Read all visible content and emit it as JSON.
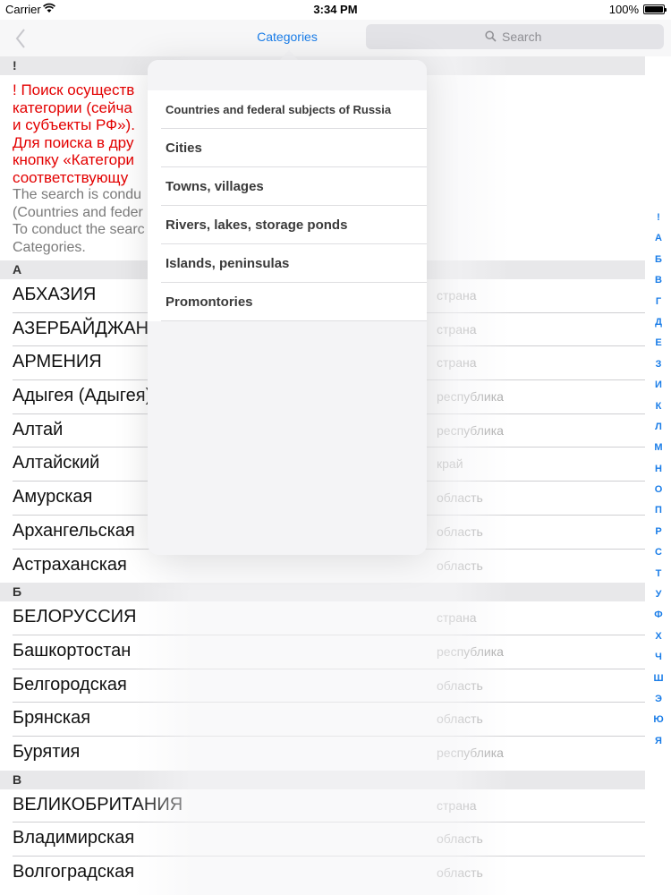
{
  "status_bar": {
    "carrier": "Carrier",
    "time": "3:34 PM",
    "battery": "100%"
  },
  "nav": {
    "categories_label": "Categories",
    "search_placeholder": "Search",
    "accent_color": "#1a7de8"
  },
  "intro": {
    "header": "!",
    "red_lines": [
      "! Поиск осуществ",
      "категории (сейча",
      "и субъекты РФ»).",
      "Для поиска в дру",
      "кнопку «Категори",
      "соответствующу"
    ],
    "gray_lines": [
      "The search is condu",
      "(Countries and feder",
      "To conduct the searc",
      "Categories."
    ]
  },
  "sections": [
    {
      "letter": "А",
      "rows": [
        {
          "name": "АБХАЗИЯ",
          "type": "страна"
        },
        {
          "name": "АЗЕРБАЙДЖАН",
          "type": "страна"
        },
        {
          "name": "АРМЕНИЯ",
          "type": "страна"
        },
        {
          "name": "Адыгея (Адыгея)",
          "type": "республика"
        },
        {
          "name": "Алтай",
          "type": "республика"
        },
        {
          "name": "Алтайский",
          "type": "край"
        },
        {
          "name": "Амурская",
          "type": "область"
        },
        {
          "name": "Архангельская",
          "type": "область"
        },
        {
          "name": "Астраханская",
          "type": "область"
        }
      ]
    },
    {
      "letter": "Б",
      "rows": [
        {
          "name": "БЕЛОРУССИЯ",
          "type": "страна"
        },
        {
          "name": "Башкортостан",
          "type": "республика"
        },
        {
          "name": "Белгородская",
          "type": "область"
        },
        {
          "name": "Брянская",
          "type": "область"
        },
        {
          "name": "Бурятия",
          "type": "республика"
        }
      ]
    },
    {
      "letter": "В",
      "rows": [
        {
          "name": "ВЕЛИКОБРИТАНИЯ",
          "type": "страна"
        },
        {
          "name": "Владимирская",
          "type": "область"
        },
        {
          "name": "Волгоградская",
          "type": "область"
        }
      ]
    }
  ],
  "index_letters": [
    "!",
    "А",
    "Б",
    "В",
    "Г",
    "Д",
    "Е",
    "З",
    "И",
    "К",
    "Л",
    "М",
    "Н",
    "О",
    "П",
    "Р",
    "С",
    "Т",
    "У",
    "Ф",
    "Х",
    "Ч",
    "Ш",
    "Э",
    "Ю",
    "Я"
  ],
  "popover": {
    "items": [
      "Countries and federal subjects of Russia",
      "Cities",
      "Towns, villages",
      "Rivers, lakes, storage ponds",
      "Islands, peninsulas",
      "Promontories"
    ]
  }
}
